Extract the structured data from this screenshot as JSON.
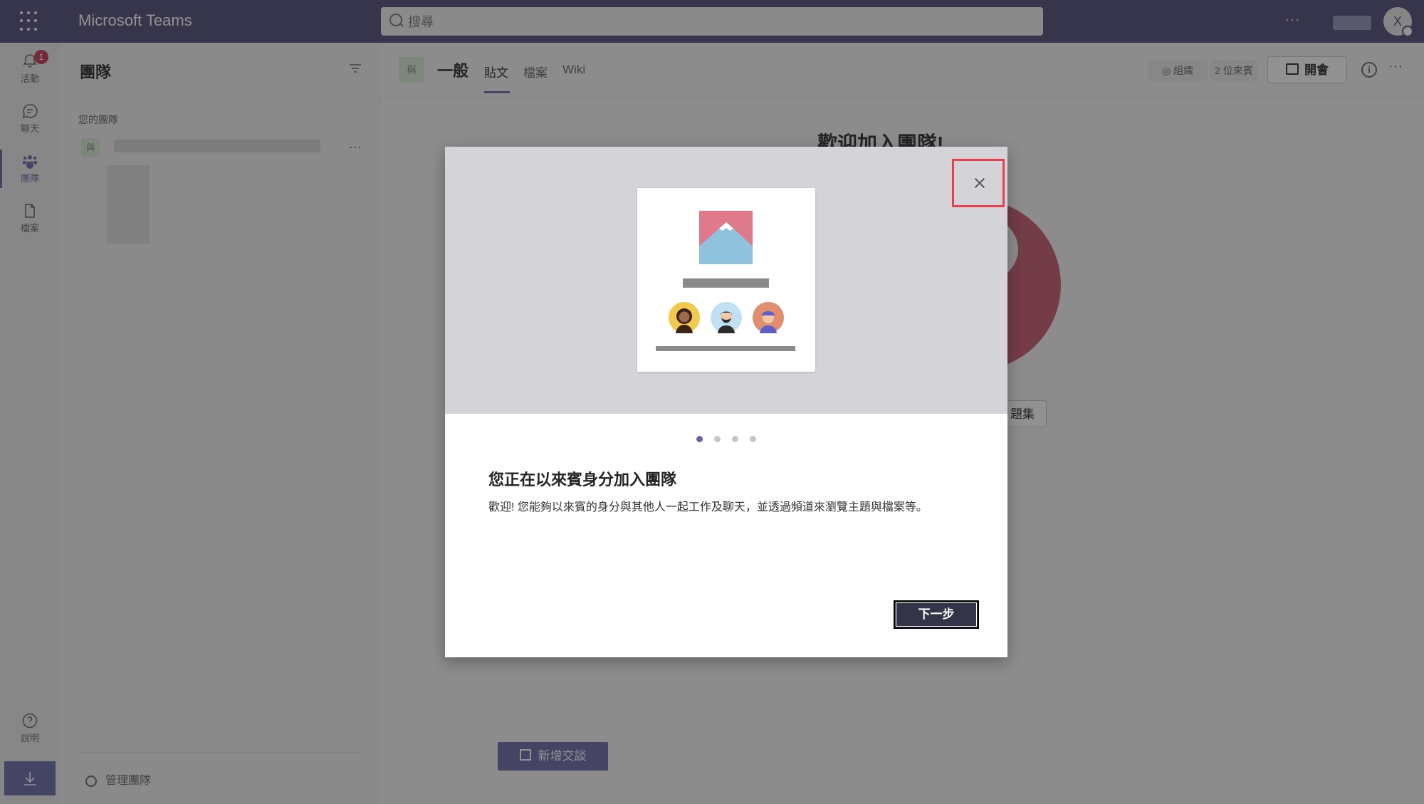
{
  "topbar": {
    "app_name": "Microsoft Teams",
    "search_placeholder": "搜尋",
    "more": "···",
    "avatar_initial": "X"
  },
  "rail": {
    "items": [
      {
        "label": "活動",
        "icon": "bell-icon",
        "badge": "1"
      },
      {
        "label": "聊天",
        "icon": "chat-icon"
      },
      {
        "label": "團隊",
        "icon": "teams-icon"
      },
      {
        "label": "檔案",
        "icon": "file-icon"
      }
    ],
    "help_label": "說明",
    "active_color": "#6264a7"
  },
  "teams_pane": {
    "title": "團隊",
    "section_label": "您的團隊",
    "team_avatar": "與",
    "team_more": "···",
    "manage_label": "管理團隊"
  },
  "channel": {
    "avatar": "與",
    "name": "一般",
    "tabs": [
      "貼文",
      "檔案",
      "Wiki"
    ],
    "org_label": "組織",
    "guests_label": "2 位來賓",
    "meet_label": "開會",
    "more": "···"
  },
  "main": {
    "welcome_title": "歡迎加入團隊!",
    "faq_label": "題集",
    "new_conversation": "新增交談"
  },
  "dialog": {
    "step": 1,
    "step_count": 4,
    "title": "您正在以來賓身分加入團隊",
    "body": "歡迎! 您能夠以來賓的身分與其他人一起工作及聊天，並透過頻道來瀏覽主題與檔案等。",
    "next_label": "下一步",
    "highlight_color": "#e8414e",
    "button_color": "#33344a"
  }
}
